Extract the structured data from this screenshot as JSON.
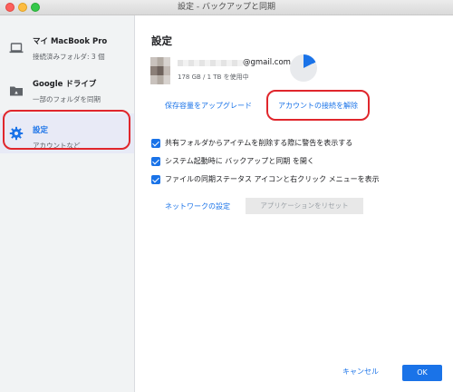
{
  "window": {
    "title": "設定 - バックアップと同期"
  },
  "sidebar": {
    "items": [
      {
        "title": "マイ MacBook Pro",
        "subtitle": "接続済みフォルダ: 3 個",
        "icon": "laptop-icon"
      },
      {
        "title": "Google ドライブ",
        "subtitle": "一部のフォルダを同期",
        "icon": "drive-folder-icon"
      },
      {
        "title": "設定",
        "subtitle": "アカウントなど",
        "icon": "gear-icon",
        "active": true
      }
    ]
  },
  "main": {
    "title": "設定",
    "account": {
      "email_visible_suffix": "@gmail.com",
      "storage": "178 GB / 1 TB を使用中",
      "storage_fraction": 0.178
    },
    "links": {
      "upgrade": "保存容量をアップグレード",
      "disconnect": "アカウントの接続を解除"
    },
    "checkboxes": [
      {
        "label": "共有フォルダからアイテムを削除する際に警告を表示する",
        "checked": true
      },
      {
        "label": "システム起動時に バックアップと同期 を開く",
        "checked": true
      },
      {
        "label": "ファイルの同期ステータス アイコンと右クリック メニューを表示",
        "checked": true
      }
    ],
    "network_settings": "ネットワークの設定",
    "reset_app": "アプリケーションをリセット"
  },
  "footer": {
    "cancel": "キャンセル",
    "ok": "OK"
  },
  "colors": {
    "accent": "#1a73e8",
    "highlight": "#e0262c"
  }
}
